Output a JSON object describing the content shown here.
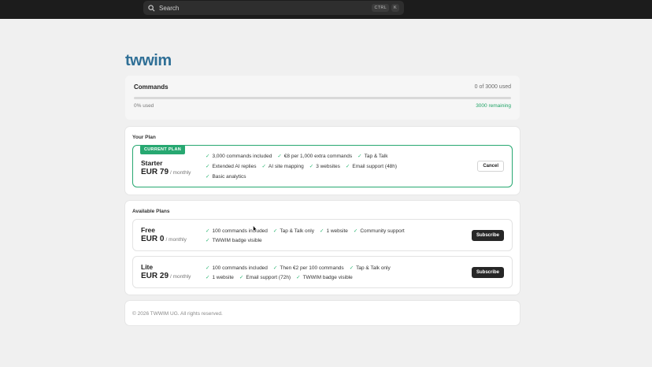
{
  "search": {
    "placeholder": "Search",
    "shortcut_ctrl": "CTRL",
    "shortcut_key": "K"
  },
  "brand": {
    "logo_text": "twwim",
    "color": "#2f6f96"
  },
  "usage": {
    "title": "Commands",
    "count_text": "0 of 3000 used",
    "progress": 0,
    "percent_text": "0% used",
    "remaining_text": "3000 remaining"
  },
  "your_plan": {
    "section_title": "Your Plan",
    "badge": "CURRENT PLAN",
    "name": "Starter",
    "price": "EUR 79",
    "period": "/ monthly",
    "features_row1": [
      "3,000 commands included",
      "€8 per 1,000 extra commands",
      "Tap & Talk"
    ],
    "features_row2": [
      "Extended AI replies",
      "AI site mapping",
      "3 websites",
      "Email support (48h)"
    ],
    "features_row3": [
      "Basic analytics"
    ],
    "cancel_label": "Cancel"
  },
  "available": {
    "section_title": "Available Plans",
    "plans": [
      {
        "name": "Free",
        "price": "EUR 0",
        "period": "/ monthly",
        "features_row1": [
          "100 commands included",
          "Tap & Talk only",
          "1 website",
          "Community support"
        ],
        "features_row2": [
          "TWWIM badge visible"
        ],
        "button_label": "Subscribe"
      },
      {
        "name": "Lite",
        "price": "EUR 29",
        "period": "/ monthly",
        "features_row1": [
          "100 commands included",
          "Then €2 per 100 commands",
          "Tap & Talk only"
        ],
        "features_row2": [
          "1 website",
          "Email support (72h)",
          "TWWIM badge visible"
        ],
        "button_label": "Subscribe"
      }
    ]
  },
  "footer": {
    "copyright": "© 2026 TWWIM UG. All rights reserved."
  },
  "colors": {
    "accent": "#27a871",
    "dark_button": "#262626",
    "topbar": "#1c1c1c"
  }
}
